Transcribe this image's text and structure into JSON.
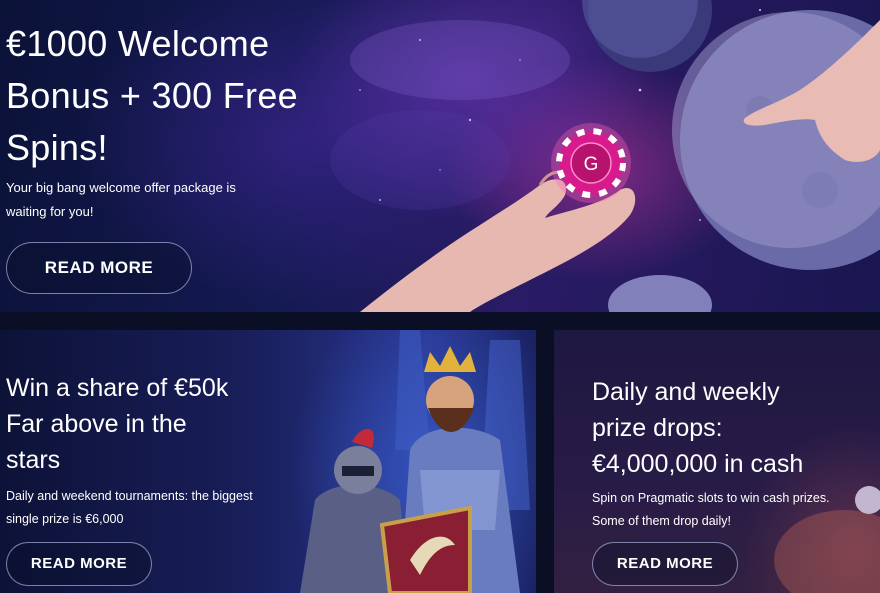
{
  "hero": {
    "title_lines": [
      "€1000 Welcome",
      "Bonus + 300 Free",
      "Spins!"
    ],
    "subtitle_lines": [
      "Your big bang welcome offer package is",
      "waiting for you!"
    ],
    "button_label": "READ MORE",
    "chip_letter": "G"
  },
  "cards": [
    {
      "title_lines": [
        "Win a share of €50k",
        "Far above in the",
        "stars"
      ],
      "subtitle_lines": [
        "Daily and weekend tournaments: the biggest",
        "single prize is €6,000"
      ],
      "button_label": "READ MORE"
    },
    {
      "title_lines": [
        "Daily and weekly",
        "prize drops:",
        "€4,000,000 in cash"
      ],
      "subtitle_lines": [
        "Spin on Pragmatic slots to win cash prizes.",
        "Some of them drop daily!"
      ],
      "button_label": "READ MORE"
    }
  ],
  "colors": {
    "background": "#0b0f26",
    "chip": "#d81b8c",
    "button_border": "#aab4dc"
  }
}
